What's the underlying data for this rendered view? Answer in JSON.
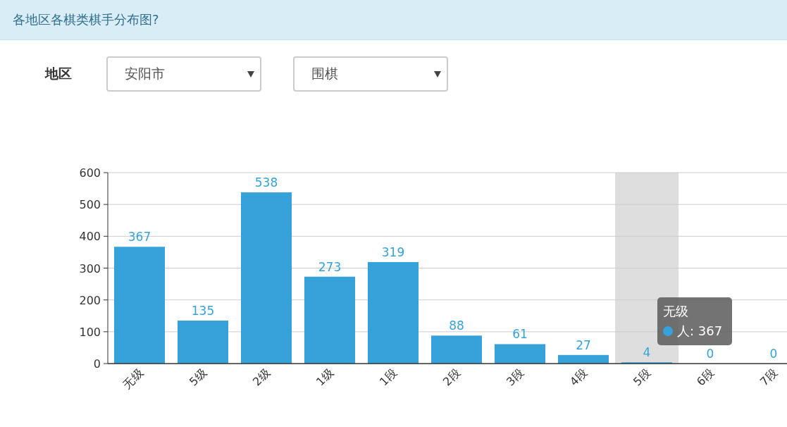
{
  "header": {
    "title": "各地区各棋类棋手分布图?"
  },
  "filters": {
    "label": "地区",
    "selects": [
      {
        "value": "安阳市"
      },
      {
        "value": "围棋"
      }
    ]
  },
  "chart": {
    "chart_data": {
      "type": "bar",
      "categories": [
        "无级",
        "5级",
        "2级",
        "1级",
        "1段",
        "2段",
        "3段",
        "4段",
        "5段",
        "6段",
        "7段"
      ],
      "series": [
        {
          "name": "人",
          "color": "#37a2da",
          "values": [
            367,
            135,
            538,
            273,
            319,
            88,
            61,
            27,
            4,
            0,
            0
          ]
        }
      ],
      "ylim": [
        0,
        600
      ],
      "yticks": [
        0,
        100,
        200,
        300,
        400,
        500,
        600
      ],
      "data_labels": true,
      "grid": true
    },
    "hover_shadow": [
      false,
      false,
      false,
      false,
      false,
      false,
      false,
      false,
      true,
      false,
      false
    ],
    "tooltip": {
      "title": "无级",
      "separator": ":",
      "value": "367"
    }
  }
}
